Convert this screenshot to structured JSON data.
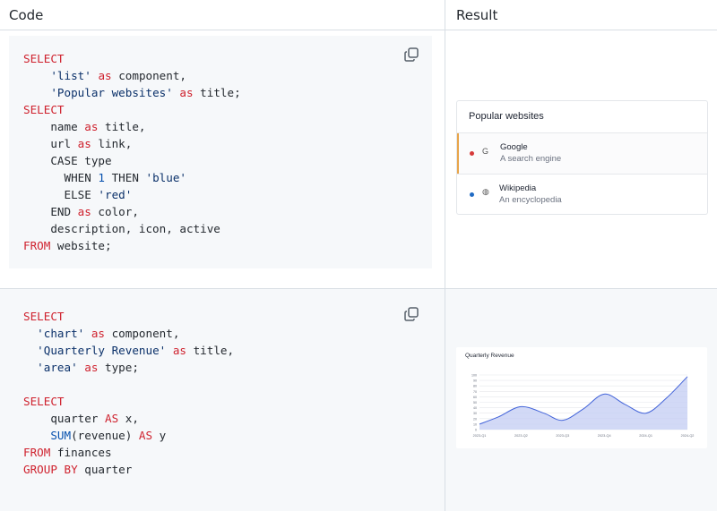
{
  "headers": {
    "code": "Code",
    "result": "Result"
  },
  "icons": {
    "copy": "copy-icon"
  },
  "example1": {
    "code_lines": [
      [
        [
          "kw",
          "SELECT"
        ]
      ],
      [
        [
          "t",
          "    "
        ],
        [
          "str",
          "'list'"
        ],
        [
          "t",
          " "
        ],
        [
          "kw",
          "as"
        ],
        [
          "t",
          " component,"
        ]
      ],
      [
        [
          "t",
          "    "
        ],
        [
          "str",
          "'Popular websites'"
        ],
        [
          "t",
          " "
        ],
        [
          "kw",
          "as"
        ],
        [
          "t",
          " title;"
        ]
      ],
      [
        [
          "kw",
          "SELECT"
        ]
      ],
      [
        [
          "t",
          "    name "
        ],
        [
          "kw",
          "as"
        ],
        [
          "t",
          " title,"
        ]
      ],
      [
        [
          "t",
          "    url "
        ],
        [
          "kw",
          "as"
        ],
        [
          "t",
          " link,"
        ]
      ],
      [
        [
          "t",
          "    CASE type"
        ]
      ],
      [
        [
          "t",
          "      WHEN "
        ],
        [
          "num",
          "1"
        ],
        [
          "t",
          " THEN "
        ],
        [
          "str",
          "'blue'"
        ]
      ],
      [
        [
          "t",
          "      ELSE "
        ],
        [
          "str",
          "'red'"
        ]
      ],
      [
        [
          "t",
          "    END "
        ],
        [
          "kw",
          "as"
        ],
        [
          "t",
          " color,"
        ]
      ],
      [
        [
          "t",
          "    description, icon, active"
        ]
      ],
      [
        [
          "kw",
          "FROM"
        ],
        [
          "t",
          " website;"
        ]
      ]
    ],
    "result": {
      "title": "Popular websites",
      "items": [
        {
          "name": "Google",
          "description": "A search engine",
          "icon_glyph": "G",
          "icon": "google-icon",
          "color": "#d63939",
          "active": true
        },
        {
          "name": "Wikipedia",
          "description": "An encyclopedia",
          "icon_glyph": "◍",
          "icon": "globe-icon",
          "color": "#206bc4",
          "active": false
        }
      ]
    }
  },
  "example2": {
    "code_lines": [
      [
        [
          "kw",
          "SELECT"
        ]
      ],
      [
        [
          "t",
          "  "
        ],
        [
          "str",
          "'chart'"
        ],
        [
          "t",
          " "
        ],
        [
          "kw",
          "as"
        ],
        [
          "t",
          " component,"
        ]
      ],
      [
        [
          "t",
          "  "
        ],
        [
          "str",
          "'Quarterly Revenue'"
        ],
        [
          "t",
          " "
        ],
        [
          "kw",
          "as"
        ],
        [
          "t",
          " title,"
        ]
      ],
      [
        [
          "t",
          "  "
        ],
        [
          "str",
          "'area'"
        ],
        [
          "t",
          " "
        ],
        [
          "kw",
          "as"
        ],
        [
          "t",
          " type;"
        ]
      ],
      [
        [
          "t",
          ""
        ]
      ],
      [
        [
          "kw",
          "SELECT"
        ]
      ],
      [
        [
          "t",
          "    quarter "
        ],
        [
          "kw",
          "AS"
        ],
        [
          "t",
          " x,"
        ]
      ],
      [
        [
          "t",
          "    "
        ],
        [
          "fn",
          "SUM"
        ],
        [
          "t",
          "(revenue) "
        ],
        [
          "kw",
          "AS"
        ],
        [
          "t",
          " y"
        ]
      ],
      [
        [
          "kw",
          "FROM"
        ],
        [
          "t",
          " finances"
        ]
      ],
      [
        [
          "kw",
          "GROUP BY"
        ],
        [
          "t",
          " quarter"
        ]
      ]
    ]
  },
  "chart_data": {
    "type": "area",
    "title": "Quarterly Revenue",
    "x": [
      "2023-Q1",
      "2023-Q2",
      "2023-Q3",
      "2023-Q4",
      "2024-Q1",
      "2024-Q2"
    ],
    "y_ticks": [
      0,
      10,
      20,
      30,
      40,
      50,
      60,
      70,
      80,
      90,
      100
    ],
    "ylim": [
      0,
      100
    ],
    "points": [
      {
        "x": 0.0,
        "y": 10
      },
      {
        "x": 0.45,
        "y": 23
      },
      {
        "x": 1.0,
        "y": 42
      },
      {
        "x": 1.55,
        "y": 30
      },
      {
        "x": 2.0,
        "y": 17
      },
      {
        "x": 2.5,
        "y": 38
      },
      {
        "x": 3.0,
        "y": 65
      },
      {
        "x": 3.5,
        "y": 46
      },
      {
        "x": 4.0,
        "y": 30
      },
      {
        "x": 4.5,
        "y": 58
      },
      {
        "x": 5.0,
        "y": 97
      }
    ],
    "colors": {
      "line": "#4263d9",
      "fill": "#c3ccf3",
      "grid": "#e6e8eb"
    }
  }
}
